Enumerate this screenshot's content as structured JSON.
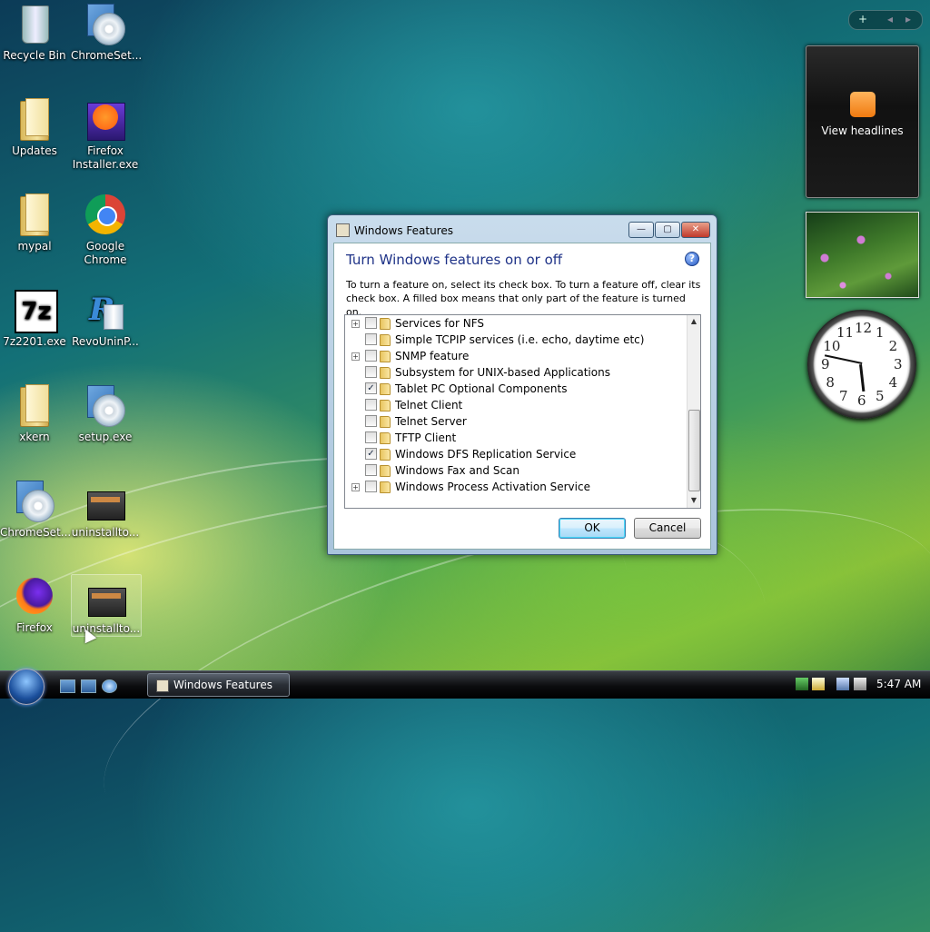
{
  "desktop_icons": [
    {
      "label": "Recycle Bin",
      "icon": "recycle-bin-icon"
    },
    {
      "label": "ChromeSet...",
      "icon": "setup-disc-icon"
    },
    {
      "label": "Updates",
      "icon": "folder-icon"
    },
    {
      "label": "Firefox Installer.exe",
      "icon": "firefox-installer-icon"
    },
    {
      "label": "mypal",
      "icon": "folder-icon"
    },
    {
      "label": "Google Chrome",
      "icon": "chrome-icon"
    },
    {
      "label": "7z2201.exe",
      "icon": "7zip-icon"
    },
    {
      "label": "RevoUninP...",
      "icon": "revo-uninstaller-icon"
    },
    {
      "label": "xkern",
      "icon": "folder-icon"
    },
    {
      "label": "setup.exe",
      "icon": "setup-disc-icon"
    },
    {
      "label": "ChromeSet...",
      "icon": "setup-disc-icon"
    },
    {
      "label": "uninstallto...",
      "icon": "uninstall-tool-icon"
    },
    {
      "label": "Firefox",
      "icon": "firefox-icon"
    },
    {
      "label": "uninstallto...",
      "icon": "uninstall-tool-icon"
    }
  ],
  "gadgets": {
    "feed_label": "View headlines",
    "clock_numbers": [
      "12",
      "1",
      "2",
      "3",
      "4",
      "5",
      "6",
      "7",
      "8",
      "9",
      "10",
      "11"
    ],
    "clock_time": {
      "hour": 5,
      "minute": 47
    }
  },
  "dialog": {
    "title": "Windows Features",
    "heading": "Turn Windows features on or off",
    "description": "To turn a feature on, select its check box. To turn a feature off, clear its check box. A filled box means that only part of the feature is turned on.",
    "help_glyph": "?",
    "controls": {
      "minimize": "—",
      "maximize": "▢",
      "close": "✕"
    },
    "features": [
      {
        "label": "Services for NFS",
        "expandable": true,
        "checked": false
      },
      {
        "label": "Simple TCPIP services (i.e. echo, daytime etc)",
        "expandable": false,
        "checked": false
      },
      {
        "label": "SNMP feature",
        "expandable": true,
        "checked": false
      },
      {
        "label": "Subsystem for UNIX-based Applications",
        "expandable": false,
        "checked": false
      },
      {
        "label": "Tablet PC Optional Components",
        "expandable": false,
        "checked": true
      },
      {
        "label": "Telnet Client",
        "expandable": false,
        "checked": false
      },
      {
        "label": "Telnet Server",
        "expandable": false,
        "checked": false
      },
      {
        "label": "TFTP Client",
        "expandable": false,
        "checked": false
      },
      {
        "label": "Windows DFS Replication Service",
        "expandable": false,
        "checked": true
      },
      {
        "label": "Windows Fax and Scan",
        "expandable": false,
        "checked": false
      },
      {
        "label": "Windows Process Activation Service",
        "expandable": true,
        "checked": false
      }
    ],
    "ok_label": "OK",
    "cancel_label": "Cancel"
  },
  "taskbar": {
    "window_button": "Windows Features",
    "time": "5:47 AM"
  }
}
